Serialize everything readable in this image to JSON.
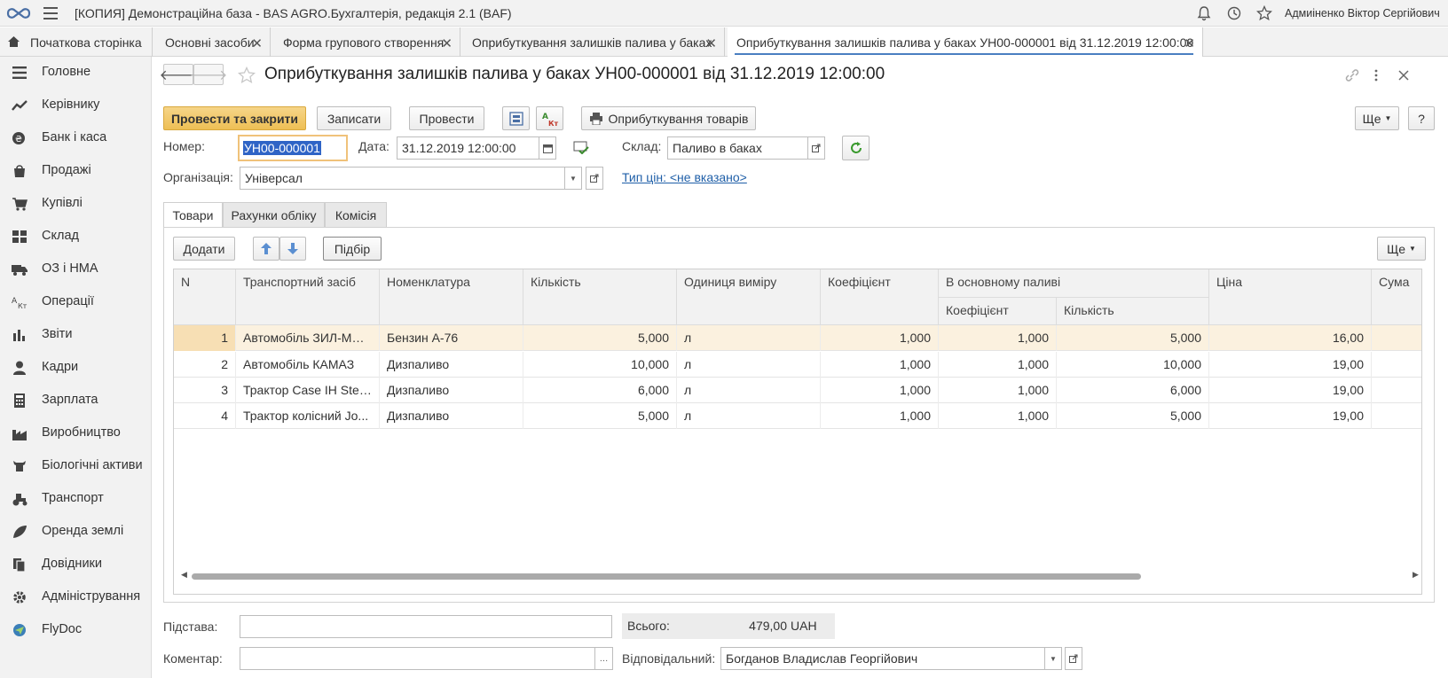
{
  "topbar": {
    "title": "[КОПИЯ] Демонстраційна база - BAS AGRO.Бухгалтерія, редакція 2.1  (BAF)",
    "user": "Адмиіненко Віктор Сергійович",
    "icons": [
      "bell-icon",
      "history-icon",
      "star-icon"
    ]
  },
  "tabs": [
    {
      "label": "Початкова сторінка"
    },
    {
      "label": "Основні засоби"
    },
    {
      "label": "Форма групового створення"
    },
    {
      "label": "Оприбуткування залишків палива у баках"
    },
    {
      "label": "Оприбуткування залишків палива у баках УН00-000001 від 31.12.2019 12:00:00"
    }
  ],
  "sidebar": {
    "items": [
      {
        "label": "Головне",
        "icon": "menu-lines-icon"
      },
      {
        "label": "Керівнику",
        "icon": "trend-icon"
      },
      {
        "label": "Банк і каса",
        "icon": "coin-icon"
      },
      {
        "label": "Продажі",
        "icon": "bag-icon"
      },
      {
        "label": "Купівлі",
        "icon": "cart-icon"
      },
      {
        "label": "Склад",
        "icon": "warehouse-icon"
      },
      {
        "label": "ОЗ і НМА",
        "icon": "truck-icon"
      },
      {
        "label": "Операції",
        "icon": "operations-icon"
      },
      {
        "label": "Звіти",
        "icon": "bars-icon"
      },
      {
        "label": "Кадри",
        "icon": "person-icon"
      },
      {
        "label": "Зарплата",
        "icon": "calculator-icon"
      },
      {
        "label": "Виробництво",
        "icon": "factory-icon"
      },
      {
        "label": "Біологічні активи",
        "icon": "cow-icon"
      },
      {
        "label": "Транспорт",
        "icon": "tractor-icon"
      },
      {
        "label": "Оренда землі",
        "icon": "leaf-icon"
      },
      {
        "label": "Довідники",
        "icon": "books-icon"
      },
      {
        "label": "Адміністрування",
        "icon": "gear-icon"
      },
      {
        "label": "FlyDoc",
        "icon": "flydoc-icon"
      }
    ]
  },
  "doc": {
    "title": "Оприбуткування залишків палива у баках УН00-000001 від 31.12.2019 12:00:00",
    "buttons": {
      "post_close": "Провести та закрити",
      "write": "Записати",
      "post": "Провести",
      "print": "Оприбуткування товарів",
      "more": "Ще",
      "help": "?"
    },
    "fields": {
      "number_label": "Номер:",
      "number": "УН00-000001",
      "date_label": "Дата:",
      "date": "31.12.2019 12:00:00",
      "warehouse_label": "Склад:",
      "warehouse": "Паливо в баках",
      "org_label": "Організація:",
      "org": "Універсал",
      "price_type_link": "Тип цін: <не вказано>"
    },
    "form_tabs": [
      "Товари",
      "Рахунки обліку",
      "Комісія"
    ],
    "table_toolbar": {
      "add": "Додати",
      "pick": "Підбір",
      "more": "Ще"
    },
    "table": {
      "headers": {
        "n": "N",
        "vehicle": "Транспортний засіб",
        "item": "Номенклатура",
        "qty": "Кількість",
        "unit": "Одиниця виміру",
        "coef": "Коефіцієнт",
        "base_fuel": "В основному паливі",
        "base_coef": "Коефіцієнт",
        "base_qty": "Кількість",
        "price": "Ціна",
        "sum": "Сума"
      },
      "rows": [
        {
          "n": "1",
          "vehicle": "Автомобіль ЗИЛ-ММ...",
          "item": "Бензин А-76",
          "qty": "5,000",
          "unit": "л",
          "coef": "1,000",
          "base_coef": "1,000",
          "base_qty": "5,000",
          "price": "16,00"
        },
        {
          "n": "2",
          "vehicle": "Автомобіль КАМАЗ",
          "item": "Дизпаливо",
          "qty": "10,000",
          "unit": "л",
          "coef": "1,000",
          "base_coef": "1,000",
          "base_qty": "10,000",
          "price": "19,00"
        },
        {
          "n": "3",
          "vehicle": "Трактор Case IH Stei...",
          "item": "Дизпаливо",
          "qty": "6,000",
          "unit": "л",
          "coef": "1,000",
          "base_coef": "1,000",
          "base_qty": "6,000",
          "price": "19,00"
        },
        {
          "n": "4",
          "vehicle": "Трактор колісний Jo...",
          "item": "Дизпаливо",
          "qty": "5,000",
          "unit": "л",
          "coef": "1,000",
          "base_coef": "1,000",
          "base_qty": "5,000",
          "price": "19,00"
        }
      ]
    },
    "footer": {
      "basis_label": "Підстава:",
      "basis": "",
      "total_label": "Всього:",
      "total": "479,00",
      "currency": "UAH",
      "comment_label": "Коментар:",
      "comment": "",
      "responsible_label": "Відповідальний:",
      "responsible": "Богданов Владислав Георгійович"
    }
  }
}
